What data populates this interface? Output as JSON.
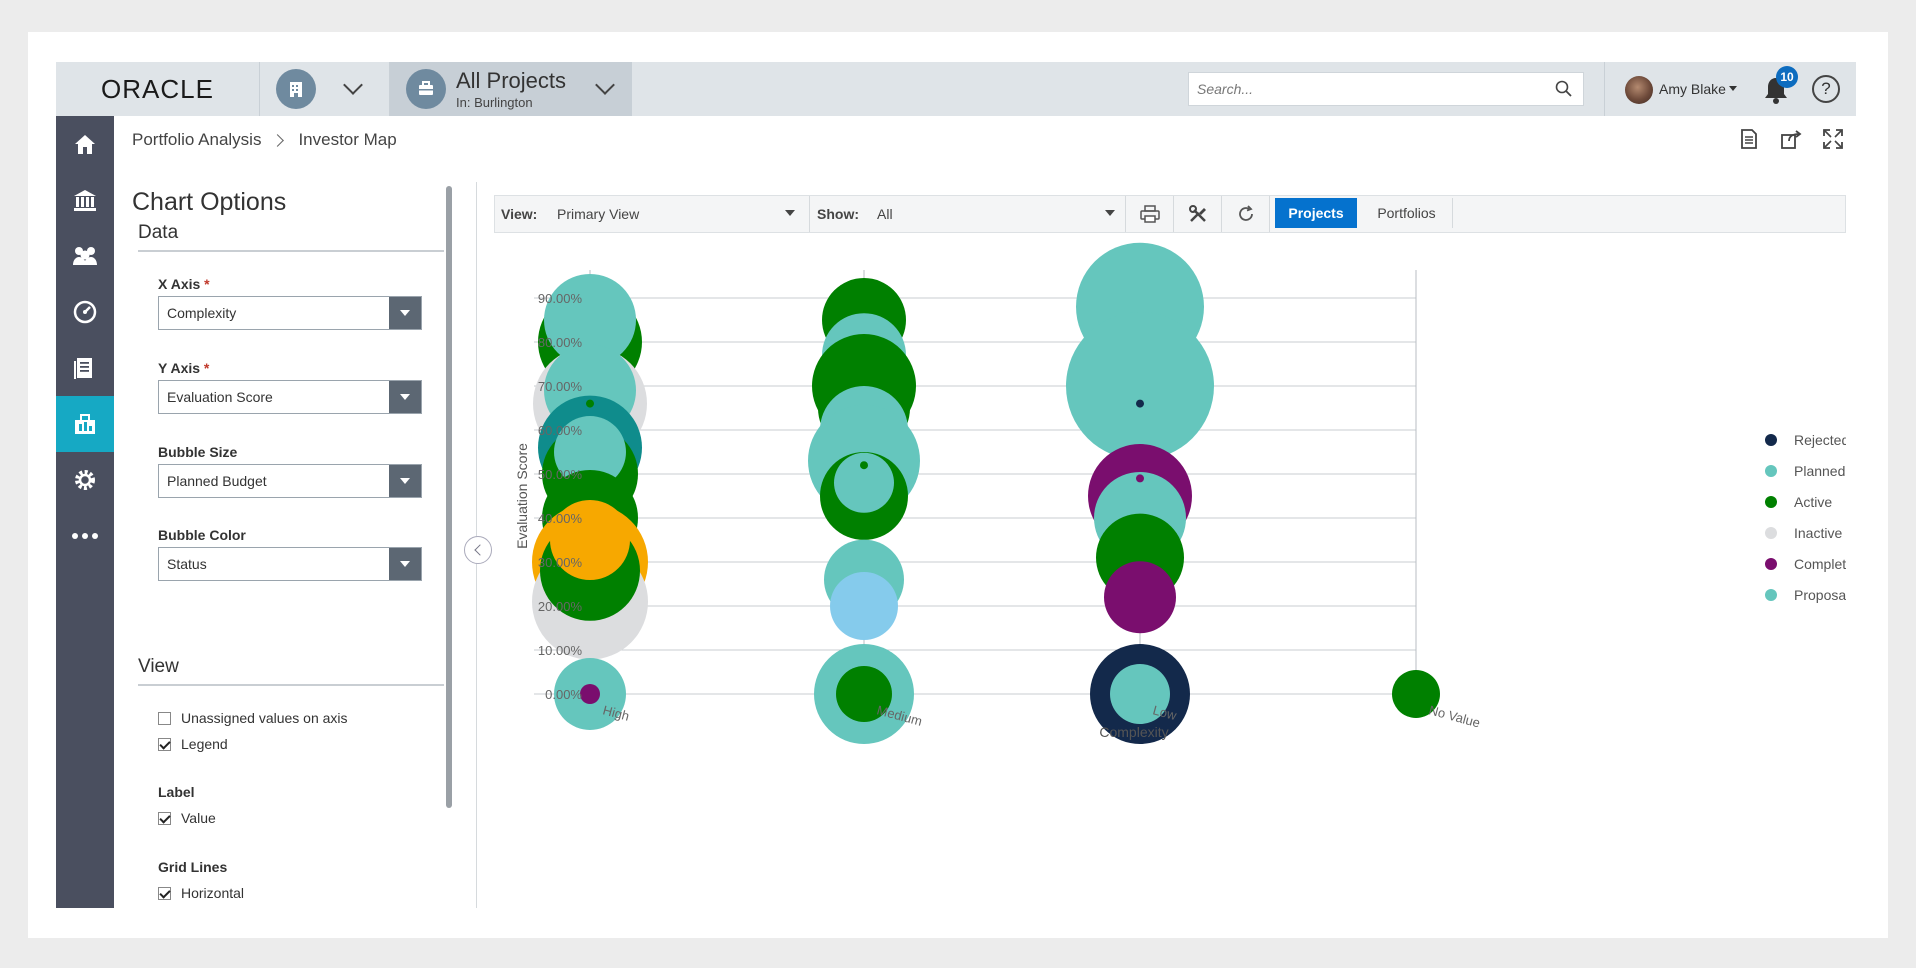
{
  "header": {
    "logo": "ORACLE",
    "project_selector": {
      "title": "All Projects",
      "subtitle": "In: Burlington"
    },
    "search": {
      "placeholder": "Search..."
    },
    "user": {
      "name": "Amy Blake"
    },
    "notifications": {
      "count": "10"
    },
    "help": "?"
  },
  "breadcrumb": {
    "parent": "Portfolio Analysis",
    "current": "Investor Map"
  },
  "options": {
    "title": "Chart Options",
    "data_section": "Data",
    "x_axis": {
      "label": "X Axis",
      "required": "*",
      "value": "Complexity"
    },
    "y_axis": {
      "label": "Y Axis",
      "required": "*",
      "value": "Evaluation Score"
    },
    "bubble_size": {
      "label": "Bubble Size",
      "value": "Planned Budget"
    },
    "bubble_color": {
      "label": "Bubble Color",
      "value": "Status"
    },
    "view_section": "View",
    "unassigned": {
      "label": "Unassigned values on axis",
      "checked": false
    },
    "legend": {
      "label": "Legend",
      "checked": true
    },
    "label_title": "Label",
    "value": {
      "label": "Value",
      "checked": true
    },
    "grid_title": "Grid Lines",
    "horizontal": {
      "label": "Horizontal",
      "checked": true
    }
  },
  "toolbar": {
    "view_label": "View:",
    "view_value": "Primary View",
    "show_label": "Show:",
    "show_value": "All",
    "projects": "Projects",
    "portfolios": "Portfolios"
  },
  "chart_data": {
    "type": "scatter",
    "xlabel": "Complexity",
    "ylabel": "Evaluation Score",
    "categories": [
      "High",
      "Medium",
      "Low",
      "No Value"
    ],
    "y_ticks": [
      "0.00%",
      "10.00%",
      "20.00%",
      "30.00%",
      "40.00%",
      "50.00%",
      "60.00%",
      "70.00%",
      "80.00%",
      "90.00%"
    ],
    "ylim": [
      0,
      90
    ],
    "legend_position": "right",
    "legend": [
      {
        "name": "Rejected",
        "color": "#13294b"
      },
      {
        "name": "Planned",
        "color": "#65c6bd"
      },
      {
        "name": "Active",
        "color": "#008000"
      },
      {
        "name": "Inactive",
        "color": "#dcdddf"
      },
      {
        "name": "Complete",
        "color": "#7a0e6e"
      },
      {
        "name": "Proposal",
        "color": "#65c6bd"
      }
    ],
    "bubbles": [
      {
        "x": "High",
        "y": 80,
        "size": 52,
        "status": "Active"
      },
      {
        "x": "High",
        "y": 66,
        "size": 57,
        "status": "Inactive"
      },
      {
        "x": "High",
        "y": 85,
        "size": 46,
        "status": "Planned"
      },
      {
        "x": "High",
        "y": 69,
        "size": 46,
        "status": "Planned"
      },
      {
        "x": "High",
        "y": 56,
        "size": 52,
        "status": "Teal"
      },
      {
        "x": "High",
        "y": 50,
        "size": 48,
        "status": "Active"
      },
      {
        "x": "High",
        "y": 55,
        "size": 36,
        "status": "Planned"
      },
      {
        "x": "High",
        "y": 40,
        "size": 48,
        "status": "Active"
      },
      {
        "x": "High",
        "y": 30,
        "size": 58,
        "status": "Proposal-Orange"
      },
      {
        "x": "High",
        "y": 21,
        "size": 58,
        "status": "Inactive"
      },
      {
        "x": "High",
        "y": 28,
        "size": 50,
        "status": "Active"
      },
      {
        "x": "High",
        "y": 35,
        "size": 40,
        "status": "Orange"
      },
      {
        "x": "High",
        "y": 66,
        "size": 4,
        "status": "Active"
      },
      {
        "x": "High",
        "y": 0,
        "size": 36,
        "status": "Planned"
      },
      {
        "x": "High",
        "y": 0,
        "size": 10,
        "status": "Complete"
      },
      {
        "x": "Medium",
        "y": 85,
        "size": 42,
        "status": "Active"
      },
      {
        "x": "Medium",
        "y": 77,
        "size": 42,
        "status": "Planned"
      },
      {
        "x": "Medium",
        "y": 70,
        "size": 52,
        "status": "Active"
      },
      {
        "x": "Medium",
        "y": 65,
        "size": 46,
        "status": "Active"
      },
      {
        "x": "Medium",
        "y": 60,
        "size": 44,
        "status": "Planned"
      },
      {
        "x": "Medium",
        "y": 53,
        "size": 56,
        "status": "Planned"
      },
      {
        "x": "Medium",
        "y": 45,
        "size": 44,
        "status": "Active"
      },
      {
        "x": "Medium",
        "y": 48,
        "size": 30,
        "status": "Planned"
      },
      {
        "x": "Medium",
        "y": 26,
        "size": 40,
        "status": "Planned"
      },
      {
        "x": "Medium",
        "y": 20,
        "size": 34,
        "status": "Sky"
      },
      {
        "x": "Medium",
        "y": 52,
        "size": 4,
        "status": "Active"
      },
      {
        "x": "Medium",
        "y": 0,
        "size": 50,
        "status": "Planned"
      },
      {
        "x": "Medium",
        "y": 0,
        "size": 28,
        "status": "Active"
      },
      {
        "x": "Low",
        "y": 88,
        "size": 64,
        "status": "Planned"
      },
      {
        "x": "Low",
        "y": 70,
        "size": 74,
        "status": "Planned"
      },
      {
        "x": "Low",
        "y": 66,
        "size": 4,
        "status": "Rejected"
      },
      {
        "x": "Low",
        "y": 45,
        "size": 52,
        "status": "Complete"
      },
      {
        "x": "Low",
        "y": 40,
        "size": 46,
        "status": "Planned"
      },
      {
        "x": "Low",
        "y": 31,
        "size": 44,
        "status": "Active"
      },
      {
        "x": "Low",
        "y": 22,
        "size": 36,
        "status": "Complete"
      },
      {
        "x": "Low",
        "y": 49,
        "size": 4,
        "status": "Complete"
      },
      {
        "x": "Low",
        "y": 0,
        "size": 50,
        "status": "Rejected"
      },
      {
        "x": "Low",
        "y": 0,
        "size": 30,
        "status": "Planned"
      },
      {
        "x": "No Value",
        "y": 0,
        "size": 24,
        "status": "Active"
      }
    ],
    "palette": {
      "Rejected": "#13294b",
      "Planned": "#65c6bd",
      "Proposal": "#65c6bd",
      "Active": "#008000",
      "Inactive": "#dcdddf",
      "Complete": "#7a0e6e",
      "Teal": "#0f8c8c",
      "Orange": "#f7a800",
      "Proposal-Orange": "#f7a800",
      "Sky": "#85cbec"
    }
  }
}
